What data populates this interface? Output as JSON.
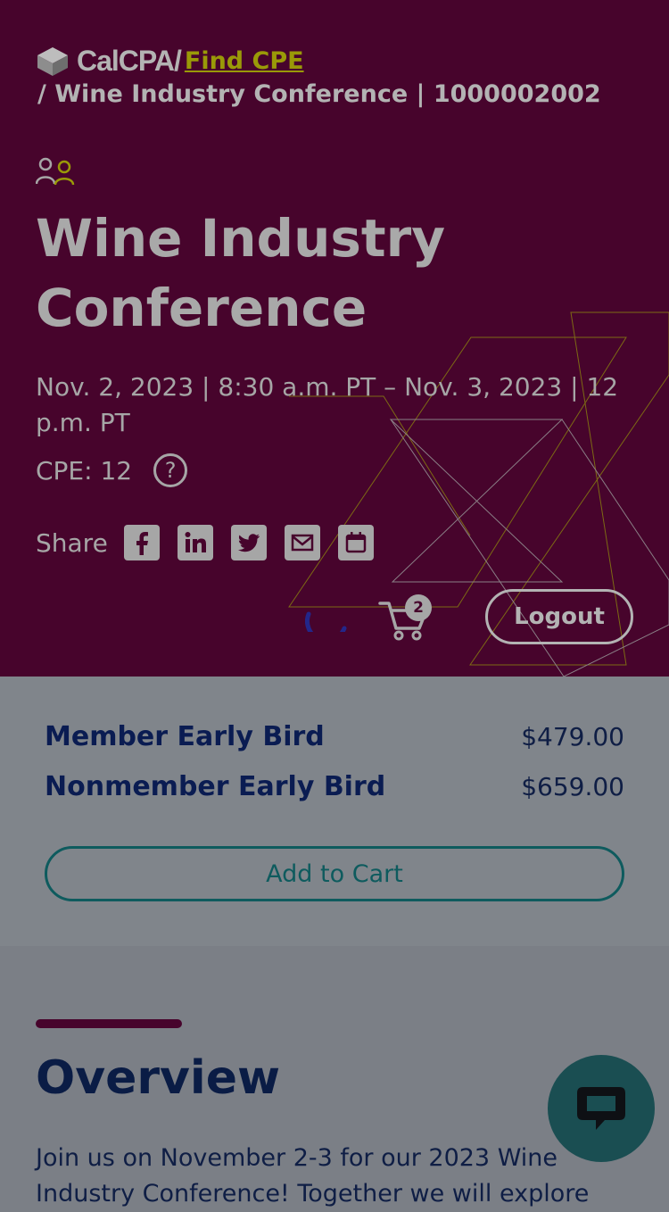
{
  "brand": {
    "logo_text": "CalCPA/",
    "find_link": "Find CPE"
  },
  "breadcrumb": "/ Wine Industry Conference | 1000002002",
  "event": {
    "title": "Wine Industry Conference",
    "dates": "Nov. 2, 2023 | 8:30 a.m. PT – Nov. 3, 2023 | 12 p.m. PT",
    "cpe": "CPE: 12",
    "help_glyph": "?"
  },
  "share": {
    "label": "Share",
    "buttons": [
      "facebook-icon",
      "linkedin-icon",
      "twitter-icon",
      "email-icon",
      "calendar-icon"
    ]
  },
  "cart": {
    "count": "2"
  },
  "logout_label": "Logout",
  "pricing": {
    "items": [
      {
        "name": "Member Early Bird",
        "price": "$479.00"
      },
      {
        "name": "Nonmember Early Bird",
        "price": "$659.00"
      }
    ],
    "add_to_cart": "Add to Cart"
  },
  "overview": {
    "title": "Overview",
    "text": "Join us on November 2-3 for our 2023 Wine Industry Conference! Together we will explore"
  },
  "colors": {
    "hero_bg": "#47042c",
    "overlay": "#7b7f86",
    "accent_gold": "#9a9a08",
    "navy": "#0a1c52",
    "teal": "#0e5b5e"
  }
}
